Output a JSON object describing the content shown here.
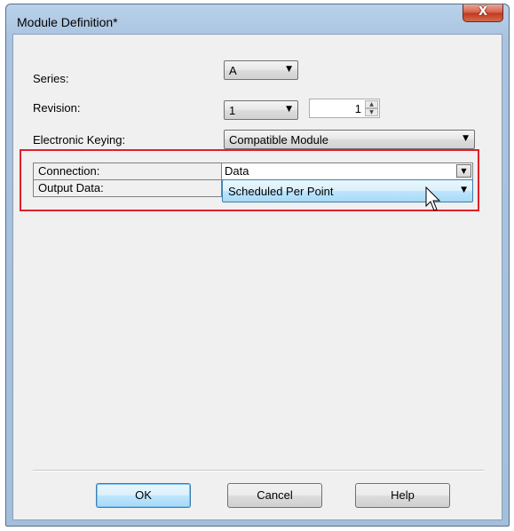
{
  "window": {
    "title": "Module Definition*",
    "close_glyph": "X"
  },
  "form": {
    "series_label": "Series:",
    "series_value": "A",
    "revision_label": "Revision:",
    "revision_major": "1",
    "revision_minor": "1",
    "keying_label": "Electronic Keying:",
    "keying_value": "Compatible Module"
  },
  "grid": {
    "rows": [
      {
        "label": "Connection:",
        "value": "Data"
      },
      {
        "label": "Output Data:",
        "value": "Scheduled Per Point"
      }
    ]
  },
  "buttons": {
    "ok": "OK",
    "cancel": "Cancel",
    "help": "Help"
  },
  "colors": {
    "highlight_border": "#e0202a",
    "selected_blue": "#3c7fb1"
  },
  "icons": [
    "close-icon",
    "chevron-down-icon",
    "spin-up-icon",
    "spin-down-icon",
    "mouse-cursor-icon"
  ]
}
